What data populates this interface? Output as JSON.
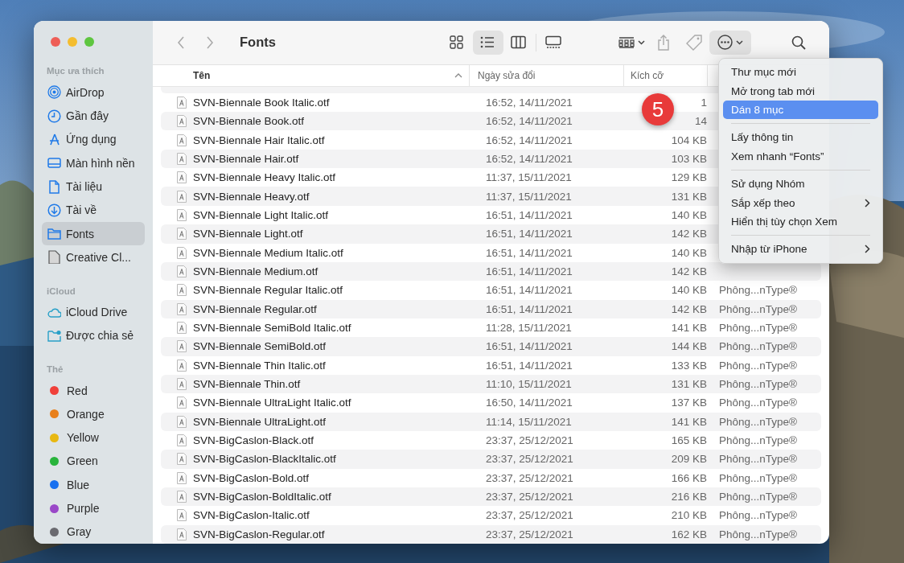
{
  "window": {
    "title": "Fonts"
  },
  "sidebar": {
    "sections": [
      {
        "title": "Mục ưa thích",
        "items": [
          {
            "label": "AirDrop",
            "selected": false
          },
          {
            "label": "Gần đây",
            "selected": false
          },
          {
            "label": "Ứng dụng",
            "selected": false
          },
          {
            "label": "Màn hình nền",
            "selected": false
          },
          {
            "label": "Tài liệu",
            "selected": false
          },
          {
            "label": "Tài về",
            "selected": false
          },
          {
            "label": "Fonts",
            "selected": true
          },
          {
            "label": "Creative Cl...",
            "selected": false
          }
        ]
      },
      {
        "title": "iCloud",
        "items": [
          {
            "label": "iCloud Drive",
            "selected": false
          },
          {
            "label": "Được chia sẻ",
            "selected": false
          }
        ]
      },
      {
        "title": "Thẻ",
        "items": [
          {
            "label": "Red",
            "selected": false,
            "color": "#f0403a"
          },
          {
            "label": "Orange",
            "selected": false,
            "color": "#e8801c"
          },
          {
            "label": "Yellow",
            "selected": false,
            "color": "#e8b812"
          },
          {
            "label": "Green",
            "selected": false,
            "color": "#28b43c"
          },
          {
            "label": "Blue",
            "selected": false,
            "color": "#1870f0"
          },
          {
            "label": "Purple",
            "selected": false,
            "color": "#9a48c8"
          },
          {
            "label": "Gray",
            "selected": false,
            "color": "#6a6a70"
          }
        ]
      }
    ]
  },
  "toolbar": {
    "view_modes": [
      {
        "selected": false
      },
      {
        "selected": true
      },
      {
        "selected": false
      },
      {
        "selected": false
      }
    ],
    "more_pressed": true
  },
  "table": {
    "columns": [
      {
        "label": "Tên",
        "sorted": true
      },
      {
        "label": "Ngày sửa đổi",
        "sorted": false
      },
      {
        "label": "Kích cỡ",
        "sorted": false
      }
    ],
    "rows": [
      {
        "name": "SVN-Biennale Book Italic.otf",
        "date": "16:52, 14/11/2021",
        "size": "1"
      },
      {
        "name": "SVN-Biennale Book.otf",
        "date": "16:52, 14/11/2021",
        "size": "14"
      },
      {
        "name": "SVN-Biennale Hair Italic.otf",
        "date": "16:52, 14/11/2021",
        "size": "104 KB"
      },
      {
        "name": "SVN-Biennale Hair.otf",
        "date": "16:52, 14/11/2021",
        "size": "103 KB"
      },
      {
        "name": "SVN-Biennale Heavy Italic.otf",
        "date": "11:37, 15/11/2021",
        "size": "129 KB"
      },
      {
        "name": "SVN-Biennale Heavy.otf",
        "date": "11:37, 15/11/2021",
        "size": "131 KB"
      },
      {
        "name": "SVN-Biennale Light Italic.otf",
        "date": "16:51, 14/11/2021",
        "size": "140 KB"
      },
      {
        "name": "SVN-Biennale Light.otf",
        "date": "16:51, 14/11/2021",
        "size": "142 KB"
      },
      {
        "name": "SVN-Biennale Medium Italic.otf",
        "date": "16:51, 14/11/2021",
        "size": "140 KB"
      },
      {
        "name": "SVN-Biennale Medium.otf",
        "date": "16:51, 14/11/2021",
        "size": "142 KB"
      },
      {
        "name": "SVN-Biennale Regular Italic.otf",
        "date": "16:51, 14/11/2021",
        "size": "140 KB",
        "kind": "Phông...nType®"
      },
      {
        "name": "SVN-Biennale Regular.otf",
        "date": "16:51, 14/11/2021",
        "size": "142 KB",
        "kind": "Phông...nType®"
      },
      {
        "name": "SVN-Biennale SemiBold Italic.otf",
        "date": "11:28, 15/11/2021",
        "size": "141 KB",
        "kind": "Phông...nType®"
      },
      {
        "name": "SVN-Biennale SemiBold.otf",
        "date": "16:51, 14/11/2021",
        "size": "144 KB",
        "kind": "Phông...nType®"
      },
      {
        "name": "SVN-Biennale Thin Italic.otf",
        "date": "16:51, 14/11/2021",
        "size": "133 KB",
        "kind": "Phông...nType®"
      },
      {
        "name": "SVN-Biennale Thin.otf",
        "date": "11:10, 15/11/2021",
        "size": "131 KB",
        "kind": "Phông...nType®"
      },
      {
        "name": "SVN-Biennale UltraLight Italic.otf",
        "date": "16:50, 14/11/2021",
        "size": "137 KB",
        "kind": "Phông...nType®"
      },
      {
        "name": "SVN-Biennale UltraLight.otf",
        "date": "11:14, 15/11/2021",
        "size": "141 KB",
        "kind": "Phông...nType®"
      },
      {
        "name": "SVN-BigCaslon-Black.otf",
        "date": "23:37, 25/12/2021",
        "size": "165 KB",
        "kind": "Phông...nType®"
      },
      {
        "name": "SVN-BigCaslon-BlackItalic.otf",
        "date": "23:37, 25/12/2021",
        "size": "209 KB",
        "kind": "Phông...nType®"
      },
      {
        "name": "SVN-BigCaslon-Bold.otf",
        "date": "23:37, 25/12/2021",
        "size": "166 KB",
        "kind": "Phông...nType®"
      },
      {
        "name": "SVN-BigCaslon-BoldItalic.otf",
        "date": "23:37, 25/12/2021",
        "size": "216 KB",
        "kind": "Phông...nType®"
      },
      {
        "name": "SVN-BigCaslon-Italic.otf",
        "date": "23:37, 25/12/2021",
        "size": "210 KB",
        "kind": "Phông...nType®"
      },
      {
        "name": "SVN-BigCaslon-Regular.otf",
        "date": "23:37, 25/12/2021",
        "size": "162 KB",
        "kind": "Phông...nType®"
      }
    ]
  },
  "context_menu": {
    "items": [
      {
        "kind": "item",
        "label": "Thư mục mới",
        "selected": false,
        "submenu": false
      },
      {
        "kind": "item",
        "label": "Mở trong tab mới",
        "selected": false,
        "submenu": false
      },
      {
        "kind": "item",
        "label": "Dán 8 mục",
        "selected": true,
        "submenu": false
      },
      {
        "kind": "separator"
      },
      {
        "kind": "item",
        "label": "Lấy thông tin",
        "selected": false,
        "submenu": false
      },
      {
        "kind": "item",
        "label": "Xem nhanh “Fonts”",
        "selected": false,
        "submenu": false
      },
      {
        "kind": "separator"
      },
      {
        "kind": "item",
        "label": "Sử dụng Nhóm",
        "selected": false,
        "submenu": false
      },
      {
        "kind": "item",
        "label": "Sắp xếp theo",
        "selected": false,
        "submenu": true
      },
      {
        "kind": "item",
        "label": "Hiển thị tùy chọn Xem",
        "selected": false,
        "submenu": false
      },
      {
        "kind": "separator"
      },
      {
        "kind": "item",
        "label": "Nhập từ iPhone",
        "selected": false,
        "submenu": true
      }
    ]
  },
  "annotation": {
    "label": "5"
  }
}
